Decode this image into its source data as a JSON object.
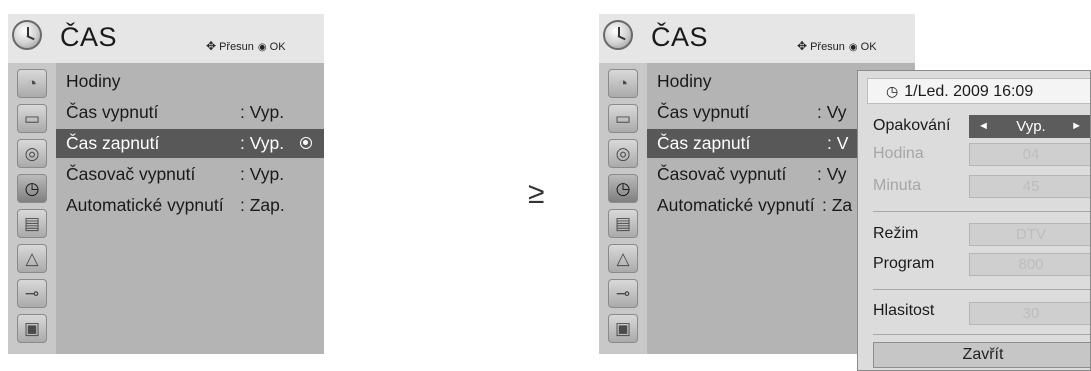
{
  "arrow": "≥",
  "left_panel": {
    "title": "ČAS",
    "hint_move": "Přesun",
    "hint_ok": "OK",
    "selected_mark": "◉",
    "items": [
      {
        "label": "Hodiny",
        "value": ""
      },
      {
        "label": "Čas vypnutí",
        "value": ": Vyp."
      },
      {
        "label": "Čas zapnutí",
        "value": ": Vyp."
      },
      {
        "label": "Časovač vypnutí",
        "value": ": Vyp."
      },
      {
        "label": "Automatické vypnutí",
        "value": ": Zap."
      }
    ],
    "selected_index": 2,
    "icons": [
      "satellite-dish-icon",
      "tv-screen-icon",
      "speaker-icon",
      "clock-icon",
      "lock-icon",
      "padlock-icon",
      "plug-icon",
      "photo-icon"
    ]
  },
  "right_panel": {
    "title": "ČAS",
    "hint_move": "Přesun",
    "hint_ok": "OK",
    "items": [
      {
        "label": "Hodiny",
        "value": ""
      },
      {
        "label": "Čas vypnutí",
        "value": ": Vy"
      },
      {
        "label": "Čas zapnutí",
        "value": ": V"
      },
      {
        "label": "Časovač vypnutí",
        "value": ": Vy"
      },
      {
        "label": "Automatické vypnutí",
        "value": ": Za"
      }
    ]
  },
  "popup": {
    "datetime": "1/Led. 2009 16:09",
    "repeat_label": "Opakování",
    "repeat_value": "Vyp.",
    "hour_label": "Hodina",
    "hour_value": "04",
    "minute_label": "Minuta",
    "minute_value": "45",
    "mode_label": "Režim",
    "mode_value": "DTV",
    "program_label": "Program",
    "program_value": "800",
    "volume_label": "Hlasitost",
    "volume_value": "30",
    "close_label": "Zavřít"
  },
  "colors": {
    "menu_body": "#b4b4b4",
    "icon_bar": "#c8c8c8",
    "header": "#e6e6e6",
    "selected_row": "#585858",
    "popup_bg": "#dcdcdc",
    "active_field": "#5c5c5c"
  }
}
